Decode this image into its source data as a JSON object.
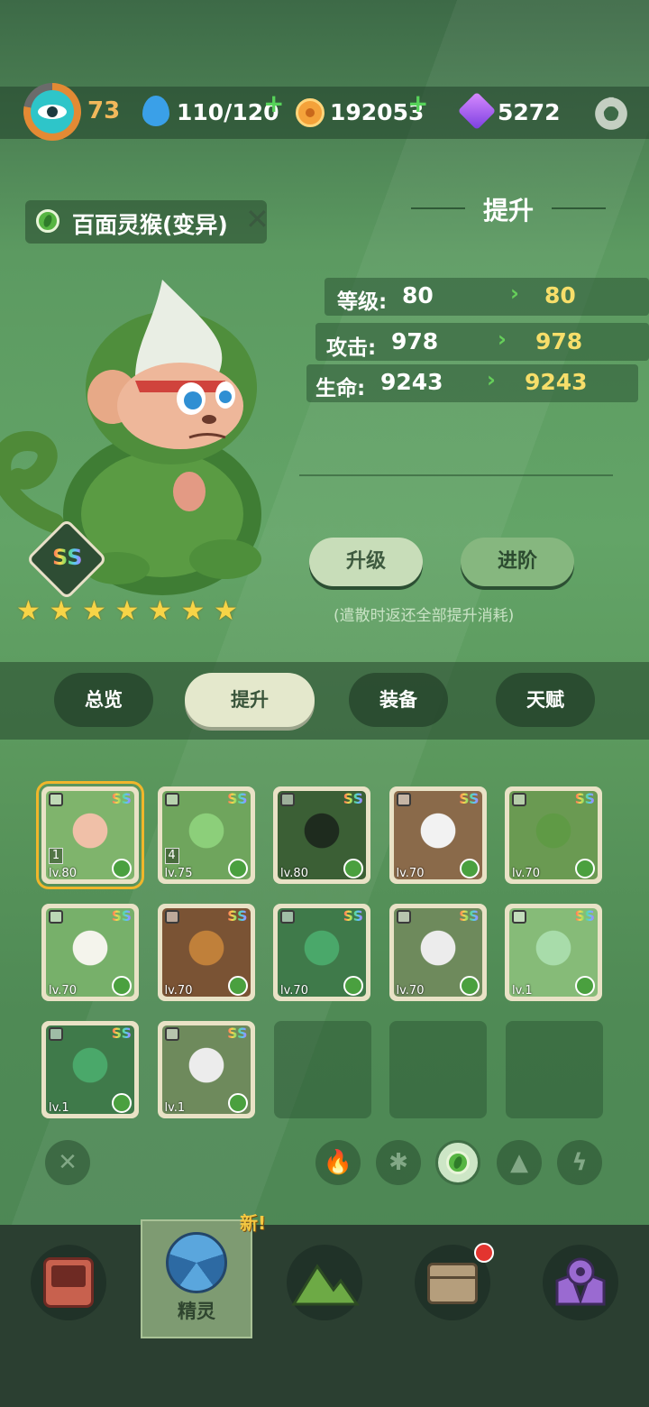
{
  "topbar": {
    "player_level": "73",
    "energy": "110/120",
    "coins": "192053",
    "gems": "5272",
    "add_symbol": "+",
    "icons": [
      "eye-avatar-icon",
      "water-drop-icon",
      "coin-icon",
      "gem-icon",
      "gear-icon"
    ]
  },
  "pet": {
    "name": "百面灵猴(变异)",
    "close_symbol": "✕",
    "rank": "SS",
    "stars": [
      "★",
      "★",
      "★",
      "★",
      "★",
      "★",
      "★"
    ]
  },
  "section": {
    "title": "提升",
    "stats": [
      {
        "label": "等级:",
        "current": "80",
        "next": "80"
      },
      {
        "label": "攻击:",
        "current": "978",
        "next": "978"
      },
      {
        "label": "生命:",
        "current": "9243",
        "next": "9243"
      }
    ],
    "arrow": "›",
    "upgrade_button": "升级",
    "advance_button": "进阶",
    "note": "(遣散时返还全部提升消耗)"
  },
  "tabs": [
    {
      "label": "总览",
      "active": false
    },
    {
      "label": "提升",
      "active": true
    },
    {
      "label": "装备",
      "active": false
    },
    {
      "label": "天赋",
      "active": false
    }
  ],
  "pets": [
    {
      "rank": "SS",
      "level": "lv.80",
      "count": "1",
      "selected": true
    },
    {
      "rank": "SS",
      "level": "lv.75",
      "count": "4"
    },
    {
      "rank": "SS",
      "level": "lv.80"
    },
    {
      "rank": "SS",
      "level": "lv.70"
    },
    {
      "rank": "SS",
      "level": "lv.70"
    },
    {
      "rank": "SS",
      "level": "lv.70"
    },
    {
      "rank": "SS",
      "level": "lv.70"
    },
    {
      "rank": "SS",
      "level": "lv.70"
    },
    {
      "rank": "SS",
      "level": "lv.70"
    },
    {
      "rank": "SS",
      "level": "lv.1"
    },
    {
      "rank": "SS",
      "level": "lv.1"
    },
    {
      "rank": "SS",
      "level": "lv.1"
    }
  ],
  "filters": {
    "clear": "✕",
    "elements": [
      "fire-icon",
      "wind-icon",
      "leaf-icon",
      "earth-icon",
      "lightning-icon"
    ]
  },
  "nav": {
    "active_label": "精灵",
    "new_badge": "新!",
    "items": [
      "console-icon",
      "spirit-icon",
      "mountain-icon",
      "bag-icon",
      "map-pin-icon"
    ]
  },
  "colors": {
    "accent": "#f7de6a",
    "leaf": "#4aa03f",
    "arrow": "#66cf5a"
  }
}
